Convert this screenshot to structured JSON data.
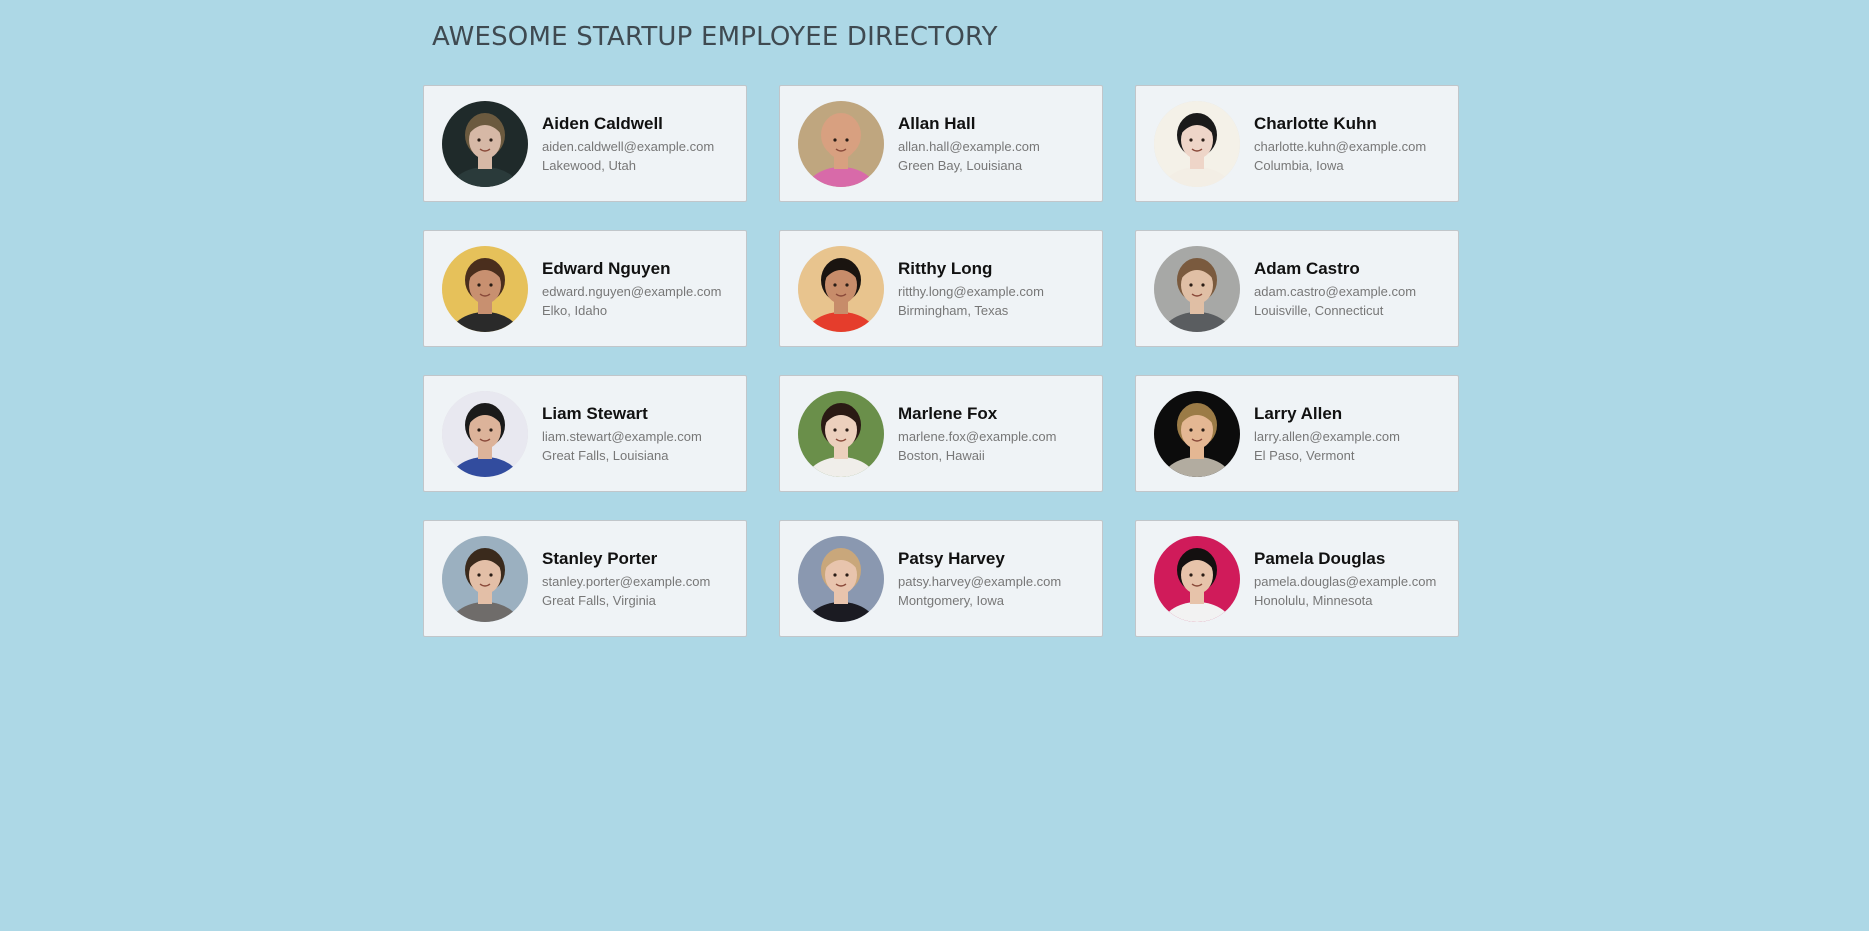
{
  "header": {
    "title": "AWESOME STARTUP EMPLOYEE DIRECTORY"
  },
  "employees": [
    {
      "name": "Aiden Caldwell",
      "email": "aiden.caldwell@example.com",
      "location": "Lakewood, Utah",
      "avatar_bg": "#1f2a2a",
      "avatar_skin": "#d6b8a6",
      "avatar_hair": "#6b5a3f",
      "avatar_shirt": "#2a3a3a"
    },
    {
      "name": "Allan Hall",
      "email": "allan.hall@example.com",
      "location": "Green Bay, Louisiana",
      "avatar_bg": "#bfa67f",
      "avatar_skin": "#d8a080",
      "avatar_hair": "#d8a080",
      "avatar_shirt": "#d86aa9"
    },
    {
      "name": "Charlotte Kuhn",
      "email": "charlotte.kuhn@example.com",
      "location": "Columbia, Iowa",
      "avatar_bg": "#f4f1e8",
      "avatar_skin": "#eed5c8",
      "avatar_hair": "#1a1a1a",
      "avatar_shirt": "#f3eee5"
    },
    {
      "name": "Edward Nguyen",
      "email": "edward.nguyen@example.com",
      "location": "Elko, Idaho",
      "avatar_bg": "#e6c15a",
      "avatar_skin": "#c89070",
      "avatar_hair": "#4a2e1d",
      "avatar_shirt": "#2a2a2a"
    },
    {
      "name": "Ritthy Long",
      "email": "ritthy.long@example.com",
      "location": "Birmingham, Texas",
      "avatar_bg": "#e8c48e",
      "avatar_skin": "#c78c6a",
      "avatar_hair": "#1a1410",
      "avatar_shirt": "#e53d2c"
    },
    {
      "name": "Adam Castro",
      "email": "adam.castro@example.com",
      "location": "Louisville, Connecticut",
      "avatar_bg": "#a7a8a6",
      "avatar_skin": "#e0bfa5",
      "avatar_hair": "#7a5a3e",
      "avatar_shirt": "#5a5d60"
    },
    {
      "name": "Liam Stewart",
      "email": "liam.stewart@example.com",
      "location": "Great Falls, Louisiana",
      "avatar_bg": "#e8e8f0",
      "avatar_skin": "#dcb39a",
      "avatar_hair": "#1a1a1a",
      "avatar_shirt": "#324c9e"
    },
    {
      "name": "Marlene Fox",
      "email": "marlene.fox@example.com",
      "location": "Boston, Hawaii",
      "avatar_bg": "#6a8f4a",
      "avatar_skin": "#ecd0bd",
      "avatar_hair": "#2a1a14",
      "avatar_shirt": "#f0eeea"
    },
    {
      "name": "Larry Allen",
      "email": "larry.allen@example.com",
      "location": "El Paso, Vermont",
      "avatar_bg": "#0c0c0c",
      "avatar_skin": "#e4b793",
      "avatar_hair": "#9b7b46",
      "avatar_shirt": "#b2aca0"
    },
    {
      "name": "Stanley Porter",
      "email": "stanley.porter@example.com",
      "location": "Great Falls, Virginia",
      "avatar_bg": "#9bb0c0",
      "avatar_skin": "#e3bfa7",
      "avatar_hair": "#3a2a1c",
      "avatar_shirt": "#6f6c6a"
    },
    {
      "name": "Patsy Harvey",
      "email": "patsy.harvey@example.com",
      "location": "Montgomery, Iowa",
      "avatar_bg": "#8a98b0",
      "avatar_skin": "#e8c4ad",
      "avatar_hair": "#c9a77b",
      "avatar_shirt": "#1b1b22"
    },
    {
      "name": "Pamela Douglas",
      "email": "pamela.douglas@example.com",
      "location": "Honolulu, Minnesota",
      "avatar_bg": "#d01b5a",
      "avatar_skin": "#e7c3aa",
      "avatar_hair": "#141010",
      "avatar_shirt": "#f2f2f2"
    }
  ]
}
